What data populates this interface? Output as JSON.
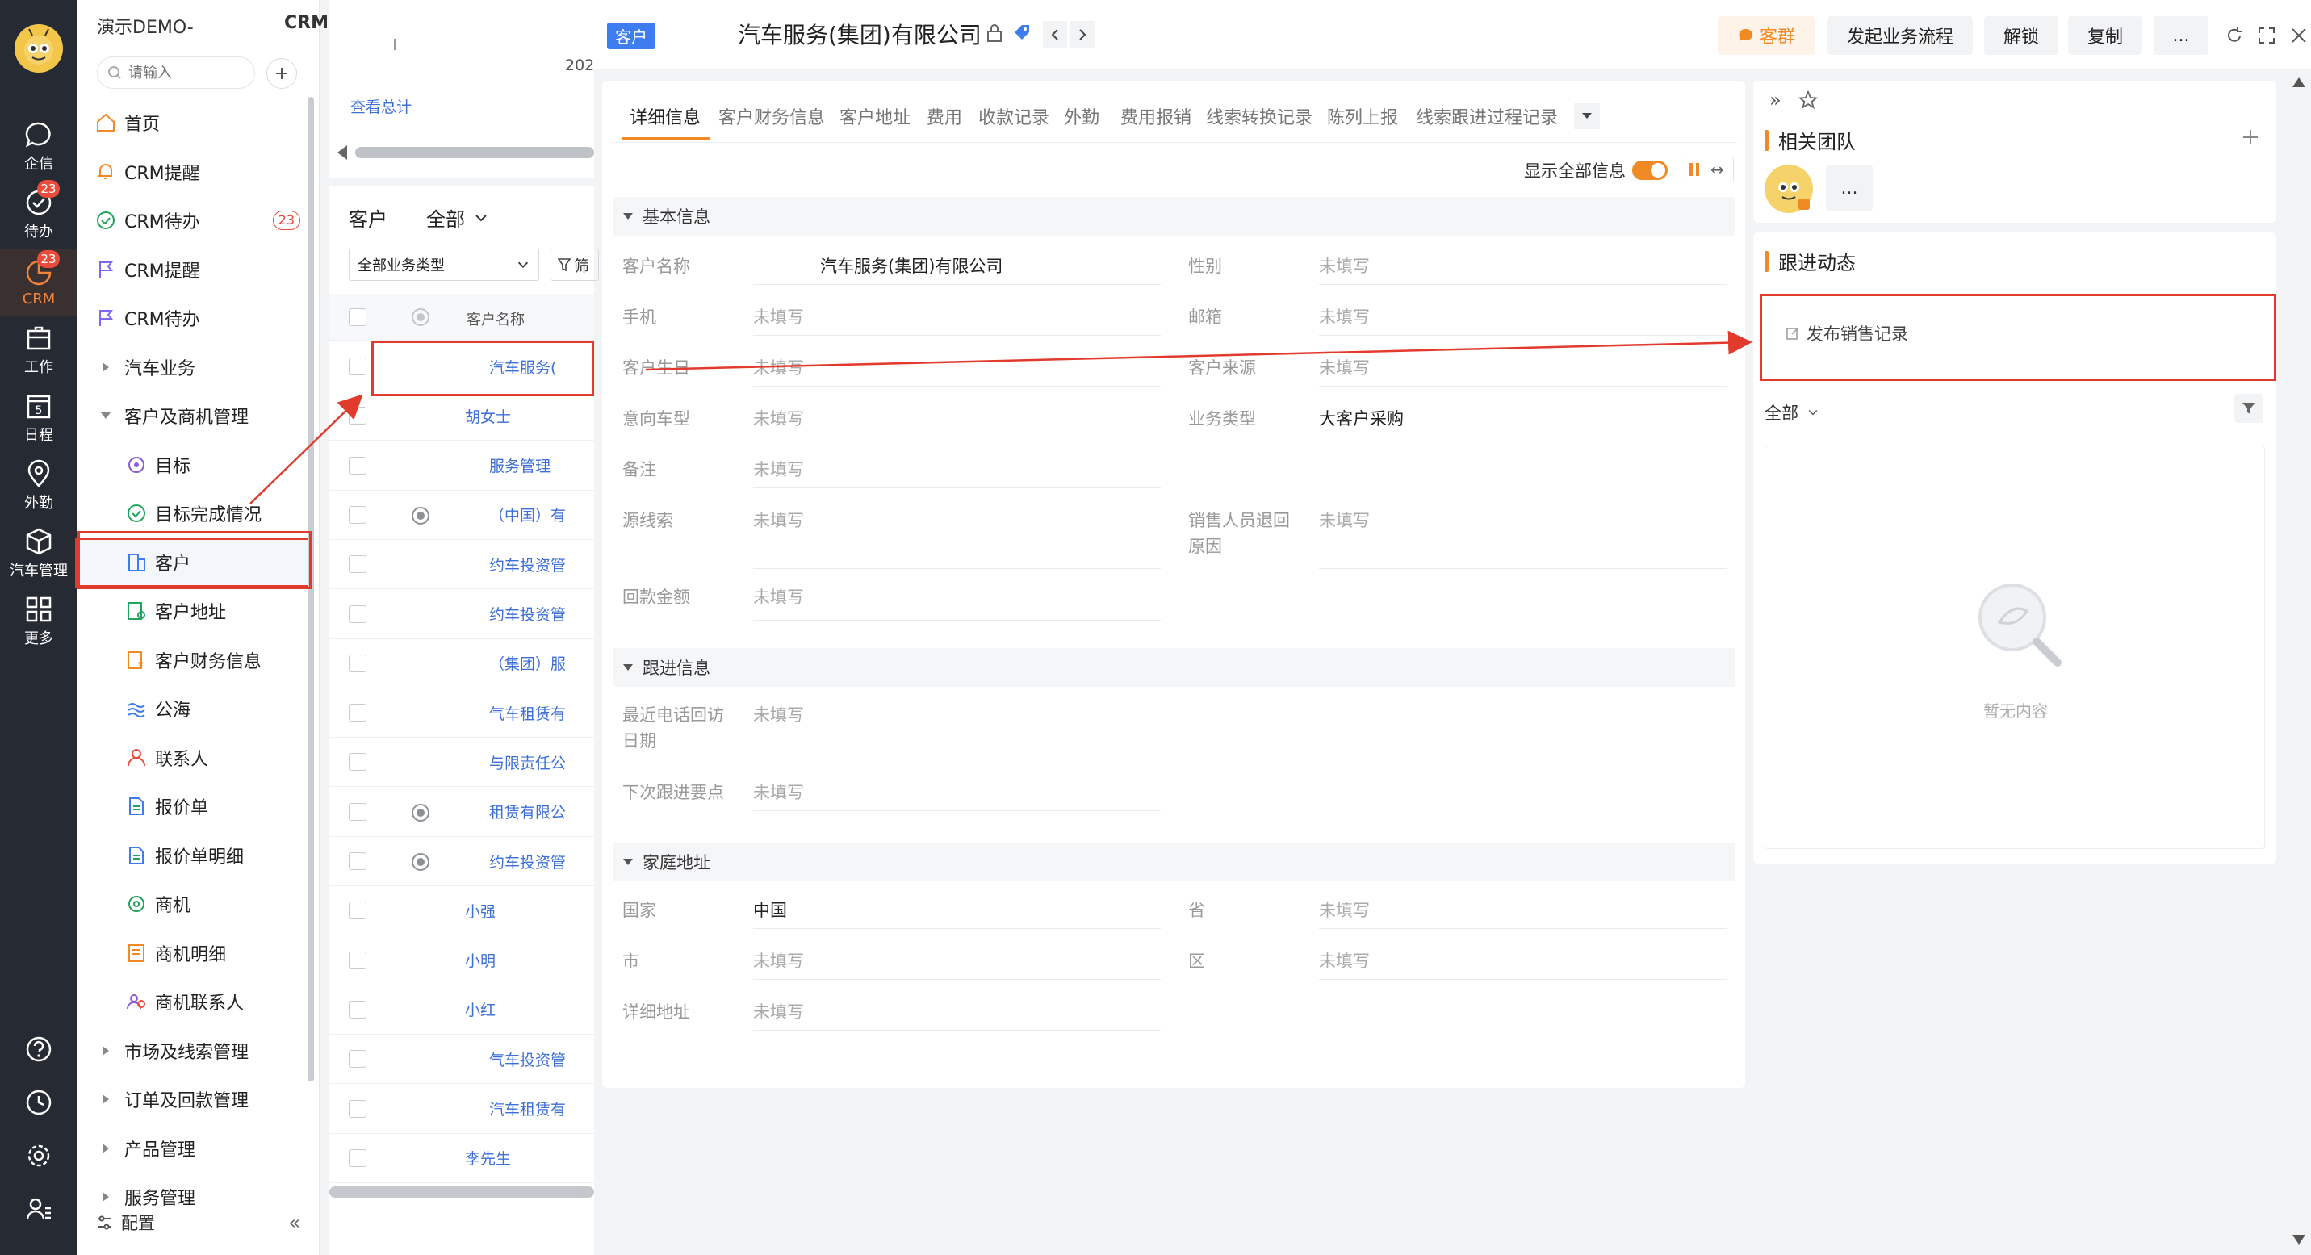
{
  "rail": {
    "items": [
      {
        "label": "企信",
        "icon": "chat-bubble-icon",
        "badge": ""
      },
      {
        "label": "待办",
        "icon": "check-circle-icon",
        "badge": "23"
      },
      {
        "label": "CRM",
        "icon": "crm-icon",
        "badge": "23"
      },
      {
        "label": "工作",
        "icon": "briefcase-icon",
        "badge": ""
      },
      {
        "label": "日程",
        "icon": "calendar-icon",
        "badge": ""
      },
      {
        "label": "外勤",
        "icon": "location-pin-icon",
        "badge": ""
      },
      {
        "label": "汽车管理",
        "icon": "cube-icon",
        "badge": ""
      },
      {
        "label": "更多",
        "icon": "grid-icon",
        "badge": ""
      }
    ],
    "calendar_day": "5"
  },
  "nav": {
    "company": "演示DEMO-",
    "module": "CRM",
    "search_placeholder": "请输入",
    "items": [
      {
        "label": "首页",
        "level": 1,
        "icon": "home-icon"
      },
      {
        "label": "CRM提醒",
        "level": 1,
        "icon": "bell-icon"
      },
      {
        "label": "CRM待办",
        "level": 1,
        "icon": "check-circle-icon",
        "badge": "23"
      },
      {
        "label": "CRM提醒",
        "level": 1,
        "icon": "flag-icon"
      },
      {
        "label": "CRM待办",
        "level": 1,
        "icon": "flag-icon"
      },
      {
        "label": "汽车业务",
        "level": 1,
        "icon": "caret-right-icon"
      },
      {
        "label": "客户及商机管理",
        "level": 1,
        "icon": "caret-down-icon"
      },
      {
        "label": "目标",
        "level": 2,
        "icon": "target-icon"
      },
      {
        "label": "目标完成情况",
        "level": 2,
        "icon": "check-circle-icon"
      },
      {
        "label": "客户",
        "level": 2,
        "icon": "building-icon",
        "selected": true
      },
      {
        "label": "客户地址",
        "level": 2,
        "icon": "address-icon"
      },
      {
        "label": "客户财务信息",
        "level": 2,
        "icon": "finance-icon"
      },
      {
        "label": "公海",
        "level": 2,
        "icon": "wave-icon"
      },
      {
        "label": "联系人",
        "level": 2,
        "icon": "person-icon"
      },
      {
        "label": "报价单",
        "level": 2,
        "icon": "document-icon"
      },
      {
        "label": "报价单明细",
        "level": 2,
        "icon": "document-icon"
      },
      {
        "label": "商机",
        "level": 2,
        "icon": "opportunity-icon"
      },
      {
        "label": "商机明细",
        "level": 2,
        "icon": "ledger-icon"
      },
      {
        "label": "商机联系人",
        "level": 2,
        "icon": "people-icon"
      },
      {
        "label": "市场及线索管理",
        "level": 1,
        "icon": "caret-right-icon"
      },
      {
        "label": "订单及回款管理",
        "level": 1,
        "icon": "caret-right-icon"
      },
      {
        "label": "产品管理",
        "level": 1,
        "icon": "caret-right-icon"
      },
      {
        "label": "服务管理",
        "level": 1,
        "icon": "caret-right-icon"
      }
    ],
    "config_label": "配置"
  },
  "list": {
    "top_text": "202",
    "top_link": "查看总计",
    "title": "客户",
    "scope": "全部",
    "biz_type": "全部业务类型",
    "filter_label": "筛",
    "header_name": "客户名称",
    "rows": [
      {
        "name": "汽车服务(",
        "icon": false,
        "selected": true
      },
      {
        "name": "胡女士",
        "icon": false
      },
      {
        "name": "服务管理",
        "icon": false
      },
      {
        "name": "（中国）有",
        "icon": true
      },
      {
        "name": "约车投资管",
        "icon": false
      },
      {
        "name": "约车投资管",
        "icon": false
      },
      {
        "name": "（集团）服",
        "icon": false
      },
      {
        "name": "气车租赁有",
        "icon": false
      },
      {
        "name": "与限责任公",
        "icon": false
      },
      {
        "name": "租赁有限公",
        "icon": true
      },
      {
        "name": "约车投资管",
        "icon": true
      },
      {
        "name": "小强",
        "icon": false
      },
      {
        "name": "小明",
        "icon": false
      },
      {
        "name": "小红",
        "icon": false
      },
      {
        "name": "气车投资管",
        "icon": false
      },
      {
        "name": "汽车租赁有",
        "icon": false
      },
      {
        "name": "李先生",
        "icon": false
      }
    ]
  },
  "detail": {
    "tag": "客户",
    "title": "汽车服务(集团)有限公司",
    "buttons": {
      "group": "客群",
      "start_flow": "发起业务流程",
      "unlock": "解锁",
      "copy": "复制",
      "more": "..."
    },
    "tabs": [
      "详细信息",
      "客户财务信息",
      "客户地址",
      "费用",
      "收款记录",
      "外勤",
      "费用报销",
      "线索转换记录",
      "陈列上报",
      "线索跟进过程记录"
    ],
    "show_all_label": "显示全部信息",
    "sections": {
      "basic": "基本信息",
      "follow": "跟进信息",
      "home": "家庭地址"
    },
    "fields": {
      "customer_name": {
        "label": "客户名称",
        "value": "汽车服务(集团)有限公司"
      },
      "gender": {
        "label": "性别",
        "value": "未填写"
      },
      "mobile": {
        "label": "手机",
        "value": "未填写"
      },
      "email": {
        "label": "邮箱",
        "value": "未填写"
      },
      "birthday": {
        "label": "客户生日",
        "value": "未填写"
      },
      "source": {
        "label": "客户来源",
        "value": "未填写"
      },
      "car_model": {
        "label": "意向车型",
        "value": "未填写"
      },
      "biz_type": {
        "label": "业务类型",
        "value": "大客户采购"
      },
      "remark": {
        "label": "备注",
        "value": "未填写"
      },
      "lead_source": {
        "label": "源线索",
        "value": "未填写"
      },
      "return_reason_l1": "销售人员退回",
      "return_reason_l2": "原因",
      "return_reason_value": "未填写",
      "payment": {
        "label": "回款金额",
        "value": "未填写"
      },
      "last_call_l1": "最近电话回访",
      "last_call_l2": "日期",
      "last_call_value": "未填写",
      "next_point": {
        "label": "下次跟进要点",
        "value": "未填写"
      },
      "country": {
        "label": "国家",
        "value": "中国"
      },
      "province": {
        "label": "省",
        "value": "未填写"
      },
      "city": {
        "label": "市",
        "value": "未填写"
      },
      "district": {
        "label": "区",
        "value": "未填写"
      },
      "address": {
        "label": "详细地址",
        "value": "未填写"
      }
    }
  },
  "right": {
    "team_title": "相关团队",
    "team_more": "...",
    "follow_title": "跟进动态",
    "publish_label": "发布销售记录",
    "filter_scope": "全部",
    "empty_text": "暂无内容"
  },
  "colors": {
    "rail_bg": "#262b33",
    "accent_orange": "#f08a24",
    "link_blue": "#3d6fd6",
    "highlight_red": "#e23b2e"
  }
}
